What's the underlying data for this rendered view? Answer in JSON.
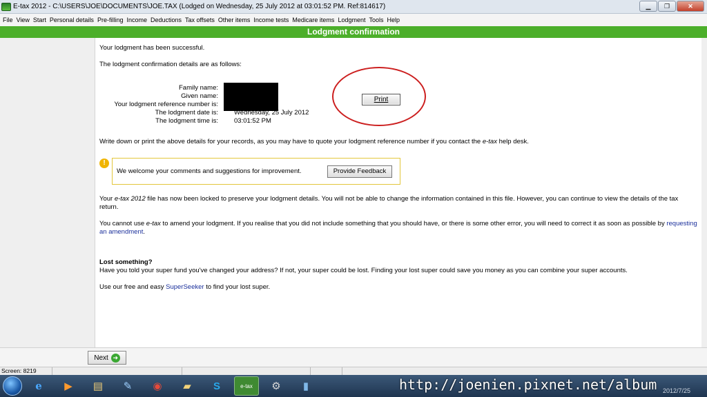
{
  "window": {
    "title": "E-tax 2012 - C:\\USERS\\JOE\\DOCUMENTS\\JOE.TAX (Lodged on Wednesday, 25 July 2012 at 03:01:52 PM.  Ref:814617)",
    "minimize": "▁",
    "maximize": "❐",
    "close": "✕"
  },
  "menu": [
    "File",
    "View",
    "Start",
    "Personal details",
    "Pre-filling",
    "Income",
    "Deductions",
    "Tax offsets",
    "Other items",
    "Income tests",
    "Medicare items",
    "Lodgment",
    "Tools",
    "Help"
  ],
  "header": {
    "title": "Lodgment confirmation"
  },
  "main": {
    "success": "Your lodgment has been successful.",
    "details_intro": "The lodgment confirmation details are as follows:",
    "labels": [
      "Family name:",
      "Given name:",
      "Your lodgment reference number is:",
      "The lodgment date is:",
      "The lodgment time is:"
    ],
    "lodgment_date": "Wednesday, 25 July 2012",
    "lodgment_time": "03:01:52 PM",
    "print_label": "Print",
    "write_down_a": "Write down or print the above details for your records, as you may have to quote your lodgment reference number if you contact the ",
    "write_down_em": "e-tax",
    "write_down_b": " help desk.",
    "feedback_text": "We welcome your comments and suggestions for improvement.",
    "feedback_button": "Provide Feedback",
    "locked_a": "Your ",
    "locked_em": "e-tax 2012",
    "locked_b": " file has now been locked to preserve your lodgment details. You will not be able to change the information contained in this file. However, you can continue to view the details of the tax return.",
    "amend_a": "You cannot use ",
    "amend_em": "e-tax",
    "amend_b": " to amend your lodgment. If you realise that you did not include something that you should have, or there is some other error, you will need to correct it as soon as possible by ",
    "amend_link": "requesting an amendment",
    "amend_end": ".",
    "lost_heading": "Lost something?",
    "lost_text": "Have you told your super fund you've changed your address? If not, your super could be lost. Finding your lost super could save you money as you can combine your super accounts.",
    "seeker_a": "Use our free and easy ",
    "seeker_link": "SuperSeeker",
    "seeker_b": " to find your lost super."
  },
  "nav": {
    "next_label": "Next"
  },
  "status": {
    "screen": "Screen: 8219"
  },
  "taskbar": {
    "icons": [
      "internet-explorer-icon",
      "media-player-icon",
      "file-explorer-icon",
      "tools-icon",
      "chrome-icon",
      "folder-icon",
      "skype-icon",
      "etax-icon",
      "settings-icon",
      "book-icon"
    ],
    "etax_label": "e-tax"
  },
  "watermark": {
    "url": "http://joenien.pixnet.net/album",
    "date": "2012/7/25"
  },
  "colors": {
    "header_green": "#4caf2a",
    "link_blue": "#1a2f9b",
    "annotation_red": "#cc1f1f"
  }
}
